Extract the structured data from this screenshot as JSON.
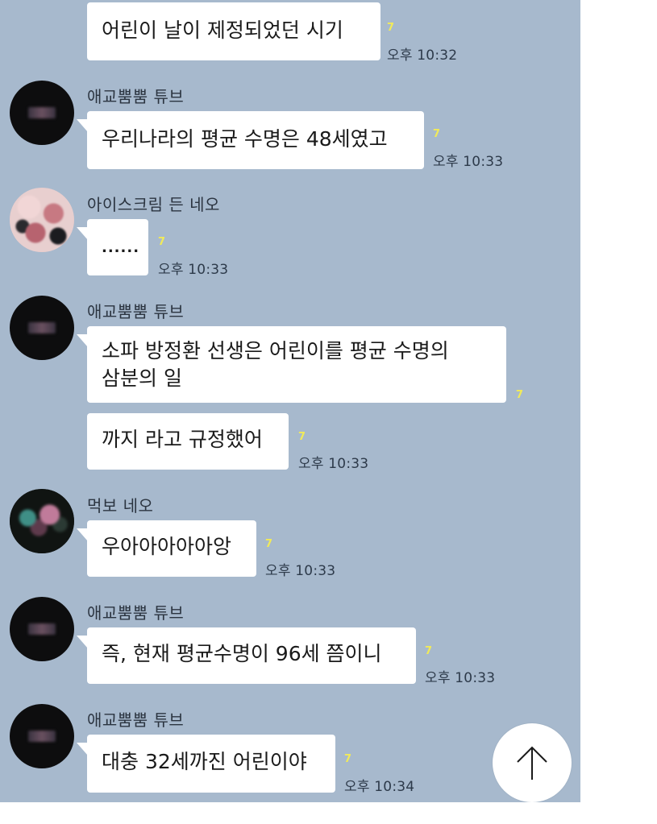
{
  "messages": [
    {
      "text": "어린이 날이 제정되었던 시기",
      "unread": "7",
      "time": "오후 10:32"
    },
    {
      "sender": "애교뿜뿜 튜브",
      "text": "우리나라의 평균 수명은 48세였고",
      "unread": "7",
      "time": "오후 10:33"
    },
    {
      "sender": "아이스크림 든 네오",
      "text": "......",
      "unread": "7",
      "time": "오후 10:33"
    },
    {
      "sender": "애교뿜뿜 튜브",
      "line1": "소파 방정환 선생은 어린이를 평균 수명의",
      "line2": "삼분의 일",
      "unread": "7"
    },
    {
      "text": "까지 라고 규정했어",
      "unread": "7",
      "time": "오후 10:33"
    },
    {
      "sender": "먹보 네오",
      "text": "우아아아아아앙",
      "unread": "7",
      "time": "오후 10:33"
    },
    {
      "sender": "애교뿜뿜 튜브",
      "text": "즉, 현재 평균수명이 96세 쯤이니",
      "unread": "7",
      "time": "오후 10:33"
    },
    {
      "sender": "애교뿜뿜 튜브",
      "text": "대충 32세까진 어린이야",
      "unread": "7",
      "time": "오후 10:34"
    }
  ],
  "controls": {
    "scroll_top_icon": "arrow-up-icon"
  },
  "colors": {
    "chat_background": "#a7b9cd",
    "bubble": "#ffffff",
    "unread_count": "#f1ea59"
  }
}
